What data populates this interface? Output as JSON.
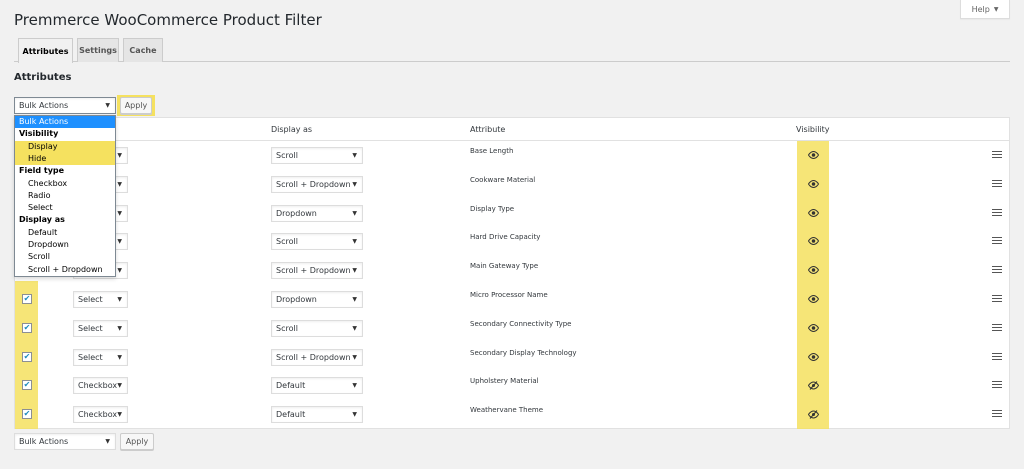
{
  "page": {
    "title": "Premmerce WooCommerce Product Filter"
  },
  "help": {
    "label": "Help",
    "caret": "▼"
  },
  "tabs": [
    {
      "label": "Attributes",
      "active": true
    },
    {
      "label": "Settings",
      "active": false
    },
    {
      "label": "Cache",
      "active": false
    }
  ],
  "section": {
    "title": "Attributes"
  },
  "bulk": {
    "selected": "Bulk Actions",
    "apply_label": "Apply"
  },
  "bulk_dropdown": {
    "items": [
      {
        "label": "Bulk Actions",
        "kind": "selected"
      },
      {
        "label": "Visibility",
        "kind": "group"
      },
      {
        "label": "Display",
        "kind": "option-highlight"
      },
      {
        "label": "Hide",
        "kind": "option-highlight"
      },
      {
        "label": "Field type",
        "kind": "group"
      },
      {
        "label": "Checkbox",
        "kind": "option"
      },
      {
        "label": "Radio",
        "kind": "option"
      },
      {
        "label": "Select",
        "kind": "option"
      },
      {
        "label": "Display as",
        "kind": "group"
      },
      {
        "label": "Default",
        "kind": "option"
      },
      {
        "label": "Dropdown",
        "kind": "option"
      },
      {
        "label": "Scroll",
        "kind": "option"
      },
      {
        "label": "Scroll + Dropdown",
        "kind": "option"
      }
    ]
  },
  "table": {
    "headers": {
      "display_as": "Display as",
      "attribute": "Attribute",
      "visibility": "Visibility"
    },
    "rows": [
      {
        "field_type": "",
        "display_as": "Scroll",
        "attribute": "Base Length",
        "checked": false,
        "visible": true
      },
      {
        "field_type": "",
        "display_as": "Scroll + Dropdown",
        "attribute": "Cookware Material",
        "checked": false,
        "visible": true
      },
      {
        "field_type": "",
        "display_as": "Dropdown",
        "attribute": "Display Type",
        "checked": false,
        "visible": true
      },
      {
        "field_type": "",
        "display_as": "Scroll",
        "attribute": "Hard Drive Capacity",
        "checked": false,
        "visible": true
      },
      {
        "field_type": "",
        "display_as": "Scroll + Dropdown",
        "attribute": "Main Gateway Type",
        "checked": false,
        "visible": true
      },
      {
        "field_type": "Select",
        "display_as": "Dropdown",
        "attribute": "Micro Processor Name",
        "checked": true,
        "visible": true
      },
      {
        "field_type": "Select",
        "display_as": "Scroll",
        "attribute": "Secondary Connectivity Type",
        "checked": true,
        "visible": true
      },
      {
        "field_type": "Select",
        "display_as": "Scroll + Dropdown",
        "attribute": "Secondary Display Technology",
        "checked": true,
        "visible": true
      },
      {
        "field_type": "Checkbox",
        "display_as": "Default",
        "attribute": "Upholstery Material",
        "checked": true,
        "visible": false
      },
      {
        "field_type": "Checkbox",
        "display_as": "Default",
        "attribute": "Weathervane Theme",
        "checked": true,
        "visible": false
      }
    ]
  },
  "bulk_bottom": {
    "selected": "Bulk Actions",
    "apply_label": "Apply"
  },
  "colors": {
    "highlight": "#f5e15f",
    "dropdown_selected": "#1e90ff",
    "checkmark": "#1e8cbe"
  },
  "icons": {
    "visible": "eye-icon",
    "hidden": "eye-slash-icon",
    "drag": "drag-handle-icon",
    "caret": "caret-down-icon"
  }
}
